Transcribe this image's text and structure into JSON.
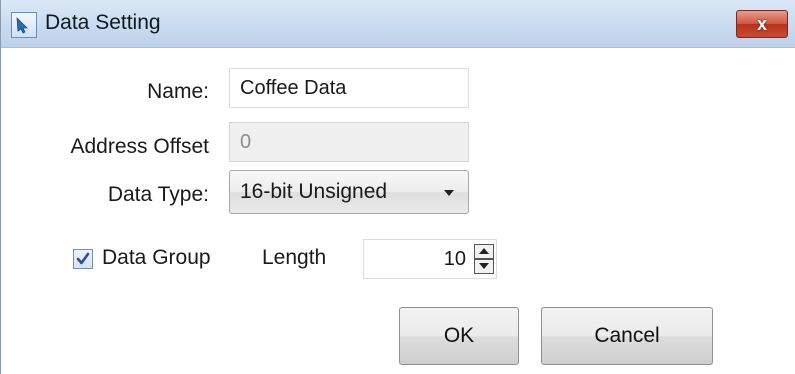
{
  "window": {
    "title": "Data Setting",
    "close_glyph": "x",
    "icon": "app-icon"
  },
  "form": {
    "name_label": "Name:",
    "name_value": "Coffee Data",
    "address_offset_label": "Address Offset",
    "address_offset_value": "0",
    "data_type_label": "Data Type:",
    "data_type_value": "16-bit Unsigned",
    "data_group_label": "Data Group",
    "data_group_checked": true,
    "length_label": "Length",
    "length_value": "10"
  },
  "buttons": {
    "ok": "OK",
    "cancel": "Cancel"
  },
  "colors": {
    "close_button": "#c84a33",
    "title_bar": "#c9dbf0",
    "checkbox_check": "#2b4f9a"
  }
}
